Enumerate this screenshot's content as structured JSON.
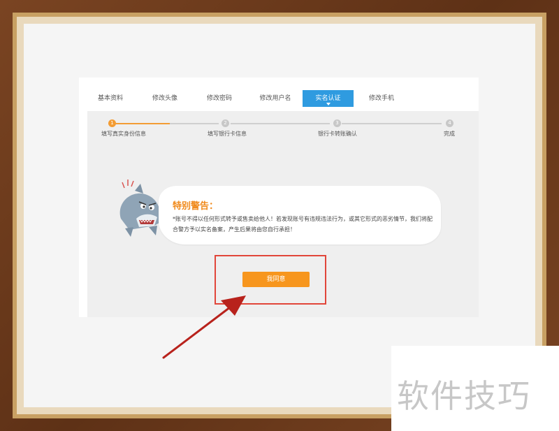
{
  "tabs": [
    {
      "label": "基本资料",
      "active": false
    },
    {
      "label": "修改头像",
      "active": false
    },
    {
      "label": "修改密码",
      "active": false
    },
    {
      "label": "修改用户名",
      "active": false
    },
    {
      "label": "实名认证",
      "active": true
    },
    {
      "label": "修改手机",
      "active": false
    }
  ],
  "steps": [
    {
      "number": "1",
      "label": "填写真实身份信息",
      "status": "active"
    },
    {
      "number": "2",
      "label": "填写银行卡信息",
      "status": "pending"
    },
    {
      "number": "3",
      "label": "银行卡转账确认",
      "status": "pending"
    },
    {
      "number": "4",
      "label": "完成",
      "status": "pending"
    }
  ],
  "warning": {
    "title": "特别警告：",
    "text": "*账号不得以任何形式转予或售卖给他人！若发现账号有违规违法行为，或其它形式的恶劣情节，我们将配合警方予以实名备案，产生后果将由您自行承担！"
  },
  "agree_button": "我同意",
  "watermark": "软件技巧",
  "colors": {
    "accent_orange": "#f7961e",
    "tab_blue": "#2f9be0",
    "highlight_red": "#e1463a",
    "arrow_red": "#b8221c"
  },
  "icons": {
    "mascot": "shark-mascot-icon",
    "arrow": "red-arrow-annotation"
  }
}
